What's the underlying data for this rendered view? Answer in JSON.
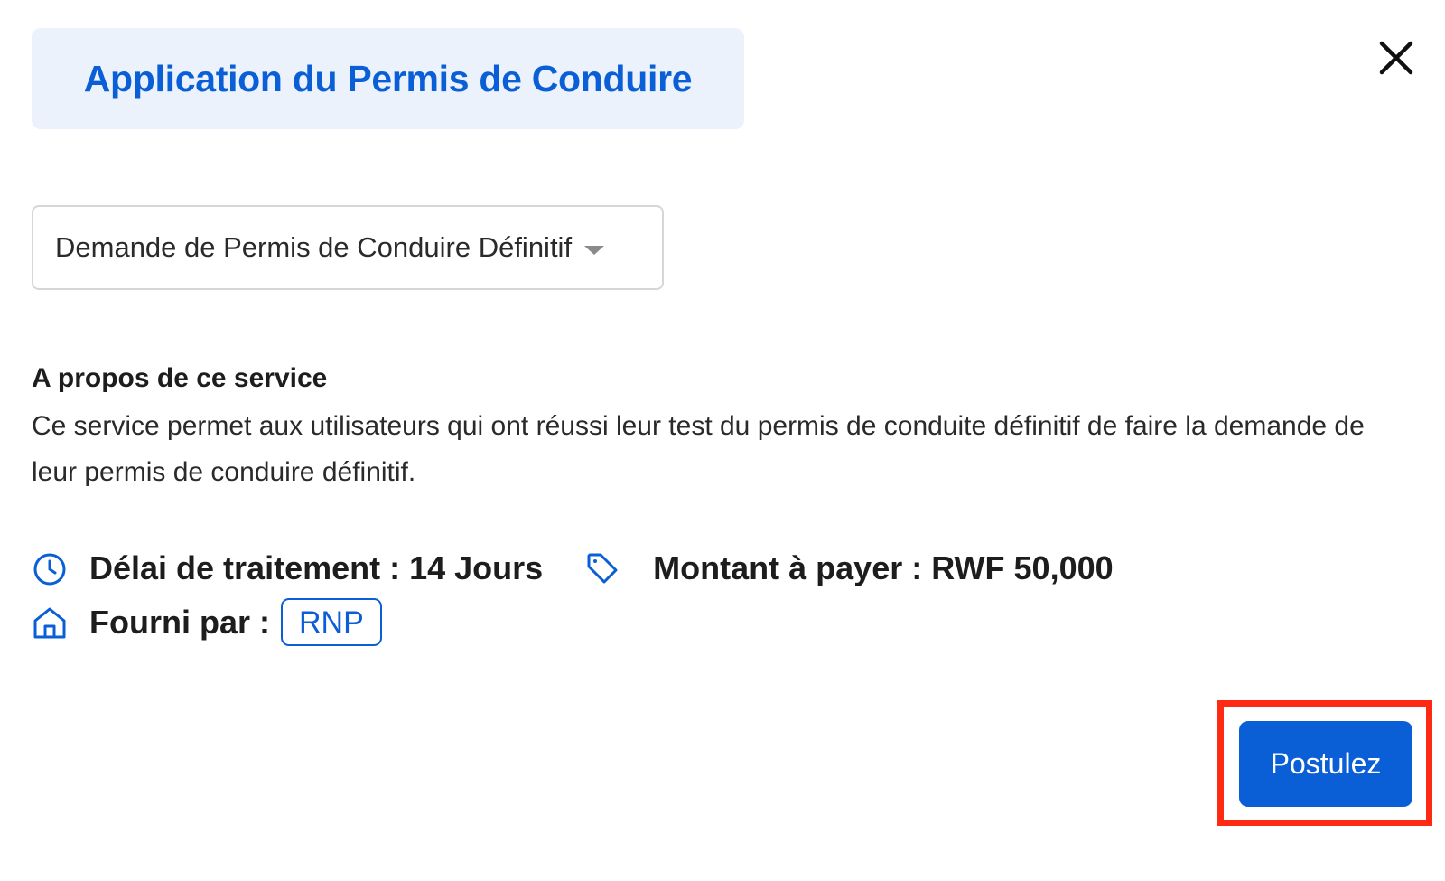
{
  "modal": {
    "title": "Application du Permis de Conduire",
    "close_icon": "close-icon"
  },
  "service_select": {
    "selected": "Demande de Permis de Conduire Définitif",
    "icon": "caret-down-icon"
  },
  "about": {
    "heading": "A propos de ce service",
    "description": "Ce service permet aux utilisateurs qui ont réussi leur test du permis de conduite définitif de faire la demande de leur permis de conduire définitif."
  },
  "details": {
    "processing_time": {
      "icon": "clock-icon",
      "label": "Délai de traitement : 14 Jours"
    },
    "amount": {
      "icon": "price-tag-icon",
      "label": "Montant à payer : RWF 50,000"
    },
    "provider": {
      "icon": "home-icon",
      "label": "Fourni par :",
      "value": "RNP"
    }
  },
  "actions": {
    "apply_label": "Postulez"
  },
  "colors": {
    "primary": "#0b5fd6",
    "title_bg": "#ebf2fc",
    "highlight": "#ff2a14"
  }
}
